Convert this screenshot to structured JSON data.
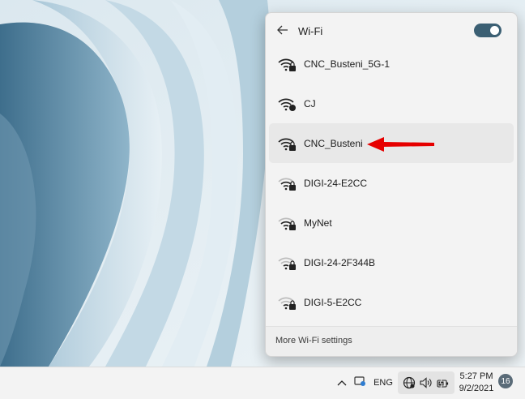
{
  "panel": {
    "title": "Wi-Fi",
    "toggle_on": true,
    "networks": [
      {
        "name": "CNC_Busteni_5G-1",
        "icon": "wifi-secured-icon",
        "highlighted": false
      },
      {
        "name": "CJ",
        "icon": "wifi-secured-icon",
        "highlighted": false
      },
      {
        "name": "CNC_Busteni",
        "icon": "wifi-secured-icon",
        "highlighted": true
      },
      {
        "name": "DIGI-24-E2CC",
        "icon": "wifi-secured-icon",
        "highlighted": false
      },
      {
        "name": "MyNet",
        "icon": "wifi-secured-icon",
        "highlighted": false
      },
      {
        "name": "DIGI-24-2F344B",
        "icon": "wifi-secured-icon",
        "highlighted": false
      },
      {
        "name": "DIGI-5-E2CC",
        "icon": "wifi-secured-icon",
        "highlighted": false
      }
    ],
    "footer_link": "More Wi-Fi settings"
  },
  "taskbar": {
    "language": "ENG",
    "time": "5:27 PM",
    "date": "9/2/2021",
    "notification_count": "16"
  },
  "colors": {
    "accent_toggle": "#3b5f73",
    "arrow": "#e60000"
  }
}
